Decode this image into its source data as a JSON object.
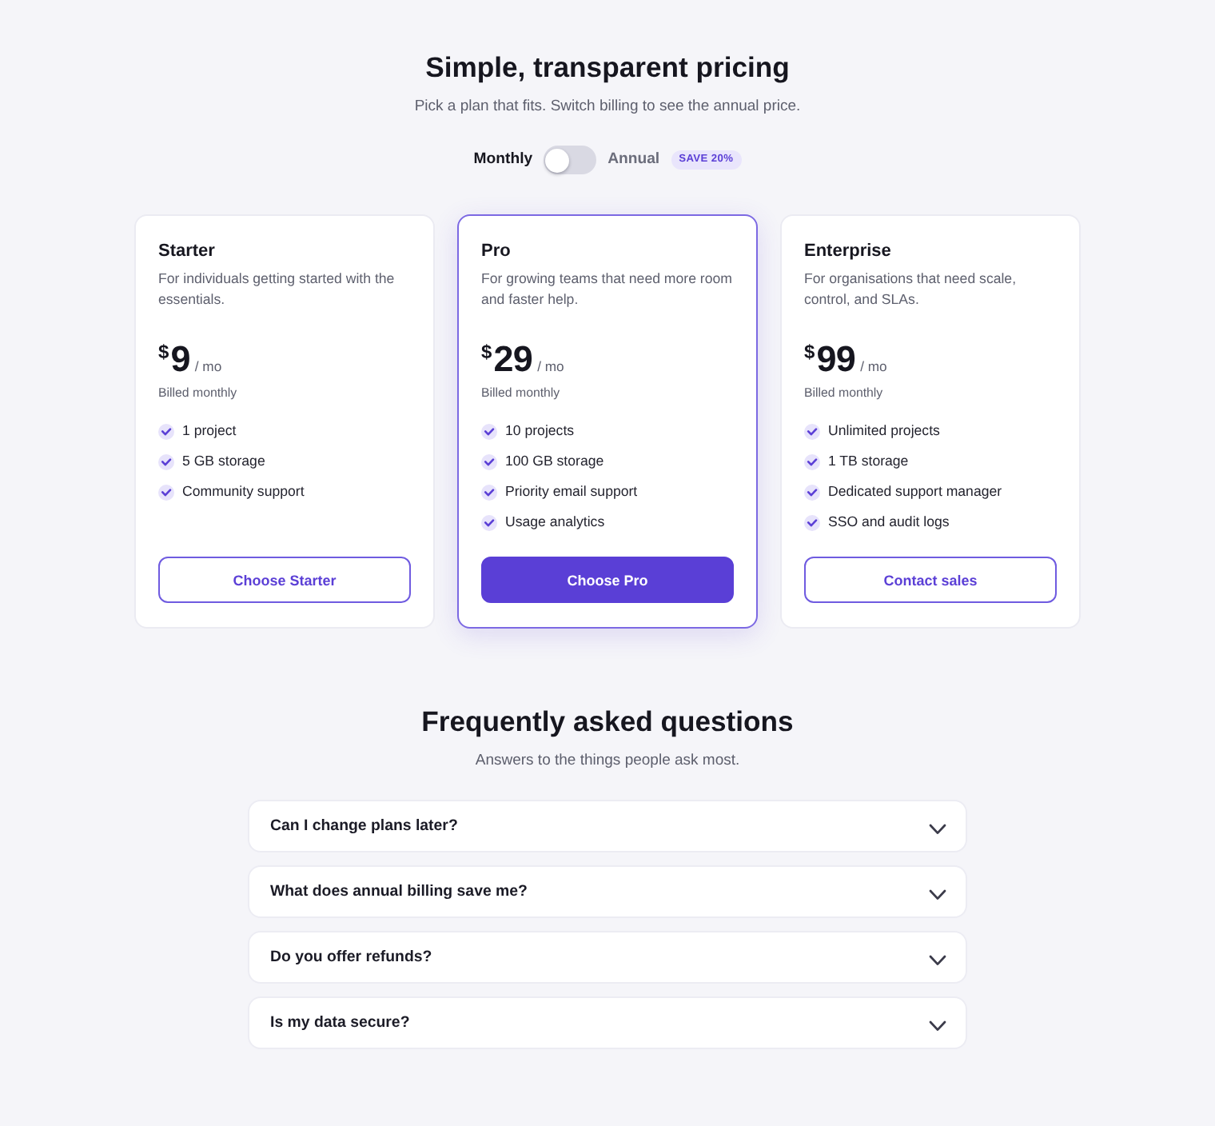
{
  "header": {
    "title": "Simple, transparent pricing",
    "subtitle": "Pick a plan that fits. Switch billing to see the annual price."
  },
  "billing": {
    "options": [
      {
        "label": "Monthly",
        "selected": true
      },
      {
        "label": "Annual",
        "selected": false
      }
    ],
    "toggle": {
      "on": false
    },
    "badge": "SAVE 20%"
  },
  "plans": [
    {
      "name": "Starter",
      "description": "For individuals getting started with the essentials.",
      "currency": "$",
      "price": "9",
      "period": "/ mo",
      "billing_note": "Billed monthly",
      "features": [
        "1 project",
        "5 GB storage",
        "Community support"
      ],
      "button": "Choose Starter",
      "featured": false
    },
    {
      "name": "Pro",
      "description": "For growing teams that need more room and faster help.",
      "currency": "$",
      "price": "29",
      "period": "/ mo",
      "billing_note": "Billed monthly",
      "features": [
        "10 projects",
        "100 GB storage",
        "Priority email support",
        "Usage analytics"
      ],
      "button": "Choose Pro",
      "featured": true
    },
    {
      "name": "Enterprise",
      "description": "For organisations that need scale, control, and SLAs.",
      "currency": "$",
      "price": "99",
      "period": "/ mo",
      "billing_note": "Billed monthly",
      "features": [
        "Unlimited projects",
        "1 TB storage",
        "Dedicated support manager",
        "SSO and audit logs"
      ],
      "button": "Contact sales",
      "featured": false
    }
  ],
  "faq": {
    "title": "Frequently asked questions",
    "subtitle": "Answers to the things people ask most.",
    "items": [
      {
        "question": "Can I change plans later?",
        "expanded": false
      },
      {
        "question": "What does annual billing save me?",
        "expanded": false
      },
      {
        "question": "Do you offer refunds?",
        "expanded": false
      },
      {
        "question": "Is my data secure?",
        "expanded": false
      }
    ]
  }
}
